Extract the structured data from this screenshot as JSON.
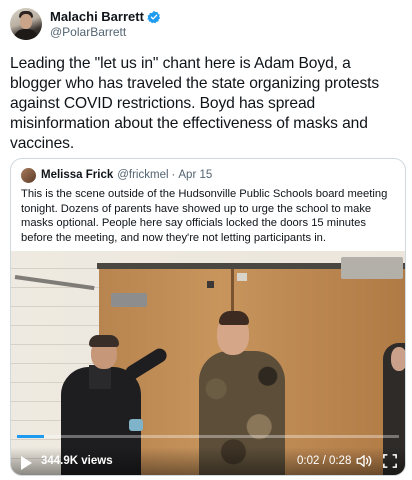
{
  "tweet": {
    "display_name": "Malachi Barrett",
    "verified": true,
    "handle": "@PolarBarrett",
    "text": "Leading the \"let us in\" chant here is Adam Boyd, a blogger who has traveled the state organizing protests against COVID restrictions. Boyd has spread misinformation about the effectiveness of masks and vaccines."
  },
  "quote": {
    "display_name": "Melissa Frick",
    "handle": "@frickmel",
    "separator": "·",
    "date": "Apr 15",
    "text": "This is the scene outside of the Hudsonville Public Schools board meeting tonight. Dozens of parents have showed up to urge the school to make masks optional. People here say officials locked the doors 15 minutes before the meeting, and now they're not letting participants in."
  },
  "video": {
    "views": "344.9K views",
    "time": "0:02 / 0:28",
    "progress_fraction": 0.07,
    "icons": [
      "play-icon",
      "volume-icon",
      "fullscreen-icon"
    ]
  },
  "colors": {
    "accent": "#1d9bf0",
    "text_primary": "#0f1419",
    "text_secondary": "#536471",
    "border": "#cfd9de"
  }
}
